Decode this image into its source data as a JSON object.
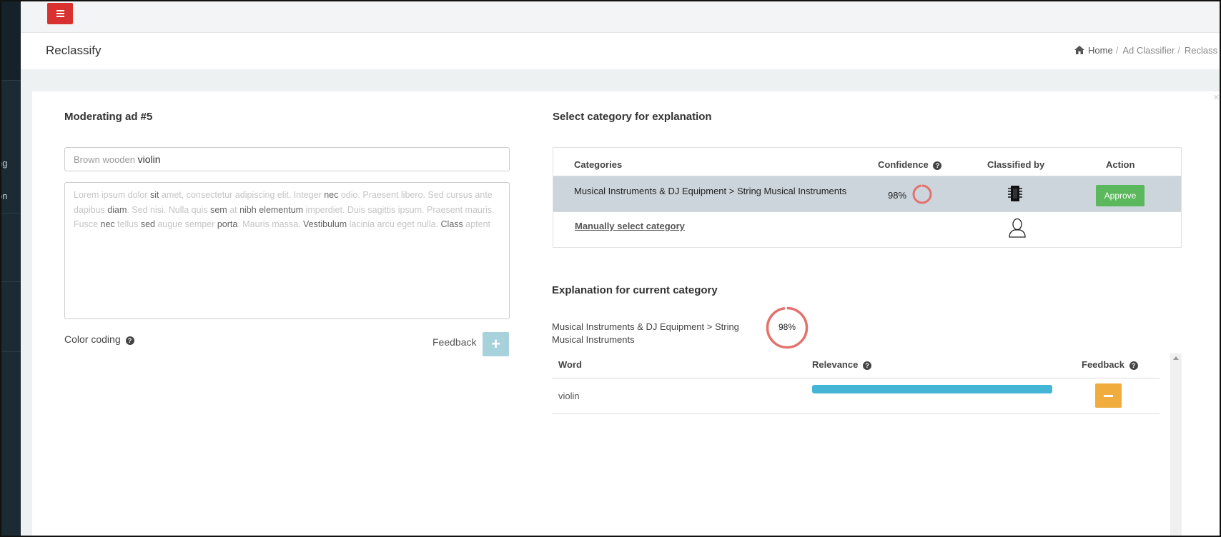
{
  "sidebar": {
    "fragments": [
      "ng",
      "on"
    ]
  },
  "topbar": {
    "menu_icon": "hamburger-icon"
  },
  "header": {
    "title": "Reclassify",
    "breadcrumb": {
      "home": "Home",
      "sep1": "/",
      "ad_classifier": "Ad Classifier",
      "sep2": "/",
      "current": "Reclass"
    }
  },
  "close_label": "×",
  "left": {
    "heading": "Moderating ad #5",
    "title_input": {
      "prefix": "Brown wooden",
      "highlight": "violin"
    },
    "description": [
      {
        "t": "Lorem ipsum dolor ",
        "h": false
      },
      {
        "t": "sit",
        "h": true
      },
      {
        "t": " amet, consectetur adipiscing elit. Integer ",
        "h": false
      },
      {
        "t": "nec",
        "h": true
      },
      {
        "t": " odio. Praesent libero. Sed cursus ante dapibus ",
        "h": false
      },
      {
        "t": "diam",
        "h": true
      },
      {
        "t": ". Sed nisi. Nulla quis ",
        "h": false
      },
      {
        "t": "sem",
        "h": true
      },
      {
        "t": " at ",
        "h": false
      },
      {
        "t": "nibh",
        "h": true
      },
      {
        "t": " ",
        "h": false
      },
      {
        "t": "elementum",
        "h": true
      },
      {
        "t": " imperdiet. Duis sagittis ipsum. Praesent mauris. Fusce ",
        "h": false
      },
      {
        "t": "nec",
        "h": true
      },
      {
        "t": " tellus ",
        "h": false
      },
      {
        "t": "sed",
        "h": true
      },
      {
        "t": " augue semper ",
        "h": false
      },
      {
        "t": "porta",
        "h": true
      },
      {
        "t": ". Mauris massa. ",
        "h": false
      },
      {
        "t": "Vestibulum",
        "h": true
      },
      {
        "t": " lacinia arcu eget nulla. ",
        "h": false
      },
      {
        "t": "Class",
        "h": true
      },
      {
        "t": " aptent",
        "h": false
      }
    ],
    "color_coding": "Color coding",
    "feedback_label": "Feedback",
    "add_feedback_symbol": "+"
  },
  "right": {
    "select_heading": "Select category for explanation",
    "table": {
      "headers": {
        "categories": "Categories",
        "confidence": "Confidence",
        "classified_by": "Classified by",
        "action": "Action"
      },
      "row": {
        "category": "Musical Instruments & DJ Equipment > String Musical Instruments",
        "confidence": "98%",
        "confidence_value": 0.98,
        "classifier_icon": "chip-icon",
        "action": "Approve"
      },
      "manual": {
        "label": "Manually select category",
        "icon": "user-icon"
      }
    },
    "explanation_heading": "Explanation for current category",
    "current_category": "Musical Instruments & DJ Equipment > String Musical Instruments",
    "current_confidence": "98%",
    "current_confidence_value": 0.98,
    "word_table": {
      "headers": {
        "word": "Word",
        "relevance": "Relevance",
        "feedback": "Feedback"
      },
      "rows": [
        {
          "word": "violin",
          "relevance": 1.0
        }
      ]
    }
  },
  "colors": {
    "menu_button": "#d9312f",
    "approve": "#5cb85c",
    "selected_row": "#ccd5dc",
    "confidence_ring": "#e4716c",
    "relevance_bar": "#45b5d6",
    "minus_button": "#f0ad3e",
    "plus_button": "#a7d2dc"
  }
}
